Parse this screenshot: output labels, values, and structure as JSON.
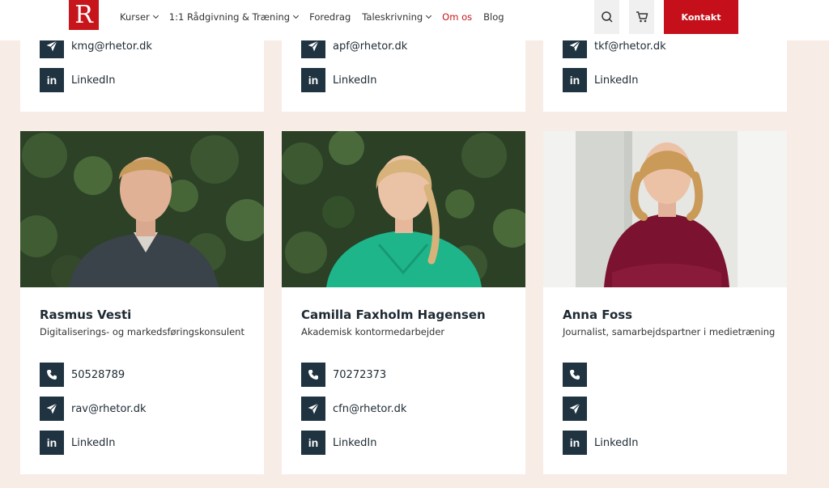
{
  "header": {
    "logo_letter": "R",
    "nav": [
      {
        "label": "Kurser",
        "has_dropdown": true
      },
      {
        "label": "1:1 Rådgivning & Træning",
        "has_dropdown": true
      },
      {
        "label": "Foredrag",
        "has_dropdown": false
      },
      {
        "label": "Taleskrivning",
        "has_dropdown": true
      },
      {
        "label": "Om os",
        "has_dropdown": false,
        "active": true
      },
      {
        "label": "Blog",
        "has_dropdown": false
      }
    ],
    "contact_label": "Kontakt"
  },
  "colors": {
    "brand_red": "#c6151b",
    "icon_bg": "#1f3340",
    "page_bg": "#f8ede6"
  },
  "top_cards": [
    {
      "email": "kmg@rhetor.dk",
      "linkedin": "LinkedIn"
    },
    {
      "email": "apf@rhetor.dk",
      "linkedin": "LinkedIn"
    },
    {
      "email": "tkf@rhetor.dk",
      "linkedin": "LinkedIn"
    }
  ],
  "people": [
    {
      "name": "Rasmus Vesti",
      "role": "Digitaliserings- og markedsføringskonsulent",
      "phone": "50528789",
      "email": "rav@rhetor.dk",
      "linkedin": "LinkedIn"
    },
    {
      "name": "Camilla Faxholm Hagensen",
      "role": "Akademisk kontormedarbejder",
      "phone": "70272373",
      "email": "cfn@rhetor.dk",
      "linkedin": "LinkedIn"
    },
    {
      "name": "Anna Foss",
      "role": "Journalist, samarbejdspartner i medietræning",
      "phone": "",
      "email": "",
      "linkedin": "LinkedIn"
    }
  ]
}
